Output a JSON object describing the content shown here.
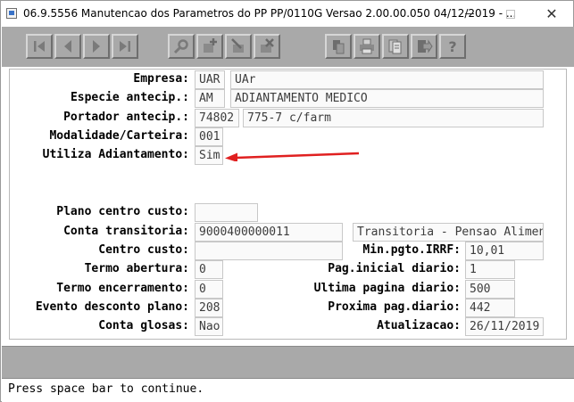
{
  "window": {
    "title": "06.9.5556 Manutencao dos  Parametros do PP PP/0110G Versao 2.00.00.050 04/12/2019 - ...",
    "minimize_symbol": "—",
    "close_symbol": "✕"
  },
  "toolbar": {
    "nav": [
      "first-icon",
      "prev-icon",
      "next-icon",
      "last-icon"
    ],
    "edit": [
      "search-icon",
      "add-icon",
      "modify-icon",
      "delete-icon"
    ],
    "tools": [
      "copy-icon",
      "print-icon",
      "notes-icon",
      "exit-icon",
      "help-icon"
    ]
  },
  "form": {
    "empresa": {
      "label": "Empresa:",
      "code": "UAR",
      "desc": "UAr"
    },
    "especie": {
      "label": "Especie antecip.:",
      "code": "AM",
      "desc": "ADIANTAMENTO MEDICO"
    },
    "portador": {
      "label": "Portador antecip.:",
      "code": "74802",
      "desc": "775-7 c/farm"
    },
    "modalidade": {
      "label": "Modalidade/Carteira:",
      "value": "001"
    },
    "utiliza": {
      "label": "Utiliza Adiantamento:",
      "value": "Sim"
    },
    "plano": {
      "label": "Plano centro custo:",
      "value": ""
    },
    "conta_transitoria": {
      "label": "Conta transitoria:",
      "value": "9000400000011",
      "desc": "Transitoria - Pensao Alimen"
    },
    "centro_custo": {
      "label": "Centro custo:",
      "value": ""
    },
    "min_pgto": {
      "label": "Min.pgto.IRRF:",
      "value": "10,01"
    },
    "termo_abertura": {
      "label": "Termo abertura:",
      "value": "0"
    },
    "pag_inicial": {
      "label": "Pag.inicial diario:",
      "value": "1"
    },
    "termo_encerramento": {
      "label": "Termo encerramento:",
      "value": "0"
    },
    "ultima_pagina": {
      "label": "Ultima pagina diario:",
      "value": "500"
    },
    "evento_desconto": {
      "label": "Evento desconto plano:",
      "value": "208"
    },
    "proxima_pag": {
      "label": "Proxima pag.diario:",
      "value": "442"
    },
    "conta_glosas": {
      "label": "Conta glosas:",
      "value": "Nao"
    },
    "atualizacao": {
      "label": "Atualizacao:",
      "value": "26/11/2019"
    }
  },
  "status": {
    "message": "Press space bar to continue."
  },
  "colors": {
    "arrow": "#e02020",
    "toolbar": "#a9a9a9"
  }
}
